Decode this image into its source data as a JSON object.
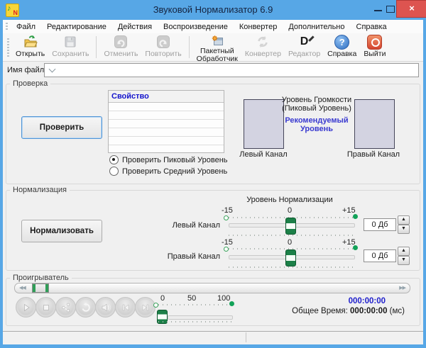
{
  "window": {
    "title": "Звуковой Нормализатор 6.9"
  },
  "menubar": {
    "items": [
      "Файл",
      "Редактирование",
      "Действия",
      "Воспроизведение",
      "Конвертер",
      "Дополнительно",
      "Справка"
    ]
  },
  "toolbar": {
    "open": "Открыть",
    "save": "Сохранить",
    "undo": "Отменить",
    "redo": "Повторить",
    "batch_line1": "Пакетный",
    "batch_line2": "Обработчик",
    "converter": "Конвертер",
    "editor": "Редактор",
    "help": "Справка",
    "exit": "Выйти"
  },
  "file_row": {
    "label": "Имя файла:",
    "value": ""
  },
  "check": {
    "group_label": "Проверка",
    "button": "Проверить",
    "table_header": "Свойство",
    "radio_peak": "Проверить Пиковый Уровень",
    "radio_avg": "Проверить Средний Уровень",
    "meter_title_line1": "Уровень Громкости",
    "meter_title_line2": "(Пиковый Уровень)",
    "recommended_line1": "Рекомендуемый",
    "recommended_line2": "Уровень",
    "left_label": "Левый Канал",
    "right_label": "Правый Канал"
  },
  "normalize": {
    "group_label": "Нормализация",
    "button": "Нормализовать",
    "title": "Уровень Нормализации",
    "left_label": "Левый Канал",
    "right_label": "Правый Канал",
    "scale": {
      "min": "-15",
      "mid": "0",
      "max": "+15"
    },
    "left_value": "0 Дб",
    "right_value": "0 Дб"
  },
  "player": {
    "group_label": "Проигрыватель",
    "volume_scale": {
      "min": "0",
      "mid": "50",
      "max": "100"
    },
    "time_current": "000:00:00",
    "total_label": "Общее Время:",
    "total_value": "000:00:00",
    "total_unit": "(мс)"
  },
  "icons": {
    "app_note": "♪",
    "app_letter": "N",
    "close": "×",
    "editor_glyph": "D",
    "help_glyph": "?",
    "seek_back": "◀◀",
    "seek_forward": "▶▶",
    "spin_up": "▲",
    "spin_down": "▼"
  },
  "colors": {
    "titlebar": "#57a7e6",
    "close_button": "#dd5450",
    "accent_green": "#12a258",
    "link_blue": "#3a3ad0",
    "table_header_blue": "#1414cc",
    "time_blue": "#2020cc"
  }
}
